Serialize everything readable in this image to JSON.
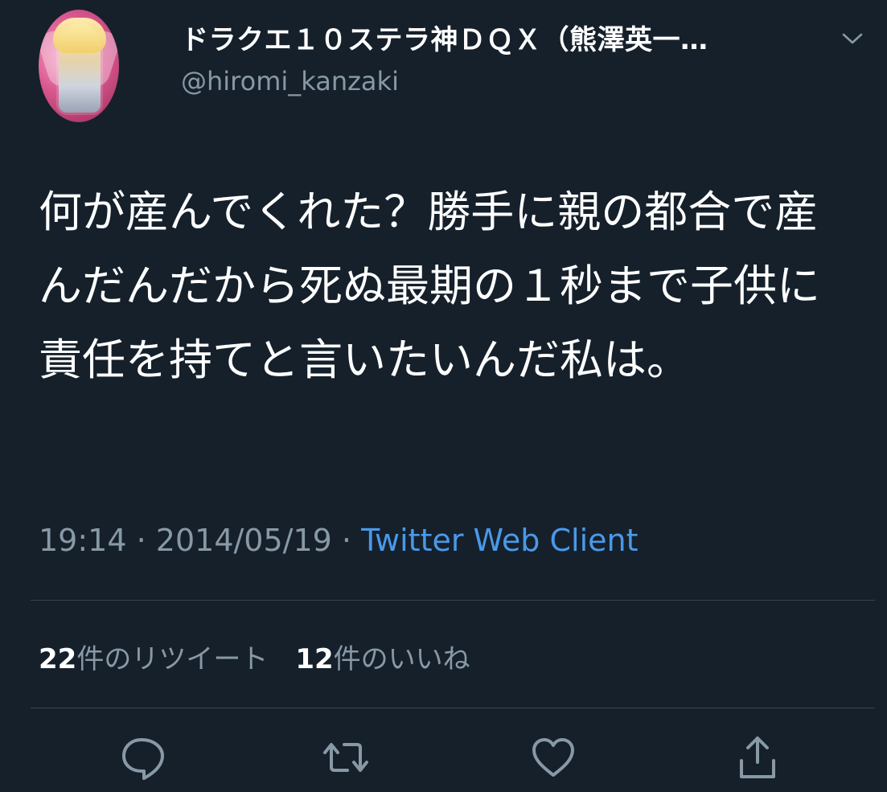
{
  "tweet": {
    "author": {
      "display_name": "ドラクエ１０ステラ神ＤＱＸ（熊澤英一…",
      "handle": "@hiromi_kanzaki"
    },
    "text": "何が産んでくれた？勝手に親の都合で産んだんだから死ぬ最期の１秒まで子供に責任を持てと言いたいんだ私は。",
    "time": "19:14",
    "date": "2014/05/19",
    "separator": "·",
    "source": "Twitter Web Client",
    "stats": {
      "retweets_count": "22",
      "retweets_label": "件のリツイート",
      "likes_count": "12",
      "likes_label": "件のいいね"
    },
    "icons": {
      "menu": "chevron-down-icon",
      "reply": "reply-icon",
      "retweet": "retweet-icon",
      "like": "like-heart-icon",
      "share": "share-icon"
    },
    "colors": {
      "background": "#15202b",
      "primary_text": "#ffffff",
      "secondary_text": "#8899a6",
      "link": "#4a99e9",
      "divider": "#38444d"
    }
  }
}
